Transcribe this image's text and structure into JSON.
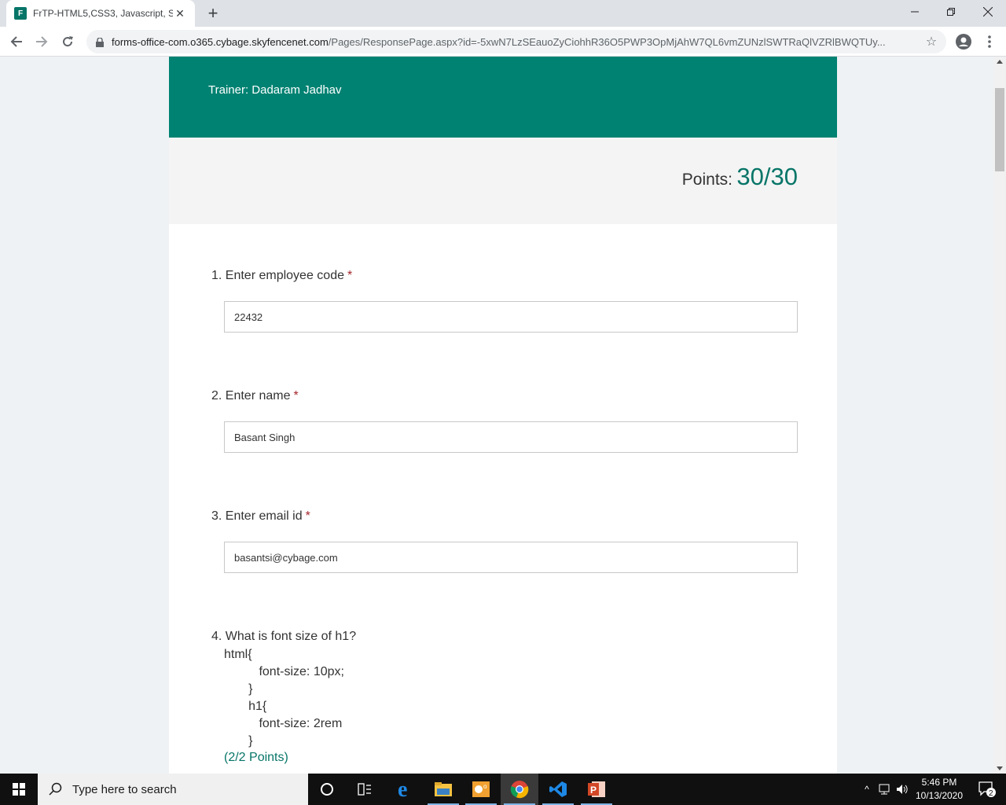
{
  "browser": {
    "tab_title": "FrTP-HTML5,CSS3, Javascript, SA",
    "favicon_text": "F",
    "url_host": "forms-office-com.o365.cybage.skyfencenet.com",
    "url_path": "/Pages/ResponsePage.aspx?id=-5xwN7LzSEauoZyCiohhR36O5PWP3OpMjAhW7QL6vmZUNzlSWTRaQlVZRlBWQTUy..."
  },
  "form": {
    "trainer": "Trainer: Dadaram Jadhav",
    "points_label": "Points:",
    "points_value": "30/30",
    "questions": [
      {
        "title": "1. Enter employee code",
        "required": "*",
        "answer": "22432"
      },
      {
        "title": "2. Enter name",
        "required": "*",
        "answer": "Basant Singh"
      },
      {
        "title": "3. Enter email id",
        "required": "*",
        "answer": "basantsi@cybage.com"
      },
      {
        "title": "4. What is font size of h1?",
        "code": [
          "html{",
          "          font-size: 10px;",
          "       }",
          "       h1{",
          "          font-size: 2rem",
          "       }"
        ],
        "points": "(2/2 Points)"
      }
    ]
  },
  "taskbar": {
    "search_placeholder": "Type here to search",
    "time": "5:46 PM",
    "date": "10/13/2020",
    "notification_count": "2"
  },
  "colors": {
    "brand": "#008272",
    "accent_text": "#077568",
    "required": "#a4262c"
  }
}
